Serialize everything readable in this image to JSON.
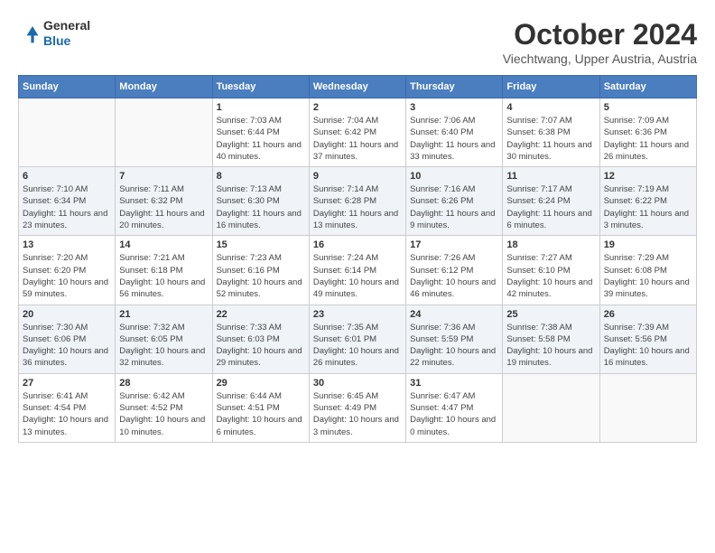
{
  "header": {
    "logo": {
      "general": "General",
      "blue": "Blue"
    },
    "title": "October 2024",
    "location": "Viechtwang, Upper Austria, Austria"
  },
  "weekdays": [
    "Sunday",
    "Monday",
    "Tuesday",
    "Wednesday",
    "Thursday",
    "Friday",
    "Saturday"
  ],
  "weeks": [
    [
      {
        "day": "",
        "sunrise": "",
        "sunset": "",
        "daylight": ""
      },
      {
        "day": "",
        "sunrise": "",
        "sunset": "",
        "daylight": ""
      },
      {
        "day": "1",
        "sunrise": "Sunrise: 7:03 AM",
        "sunset": "Sunset: 6:44 PM",
        "daylight": "Daylight: 11 hours and 40 minutes."
      },
      {
        "day": "2",
        "sunrise": "Sunrise: 7:04 AM",
        "sunset": "Sunset: 6:42 PM",
        "daylight": "Daylight: 11 hours and 37 minutes."
      },
      {
        "day": "3",
        "sunrise": "Sunrise: 7:06 AM",
        "sunset": "Sunset: 6:40 PM",
        "daylight": "Daylight: 11 hours and 33 minutes."
      },
      {
        "day": "4",
        "sunrise": "Sunrise: 7:07 AM",
        "sunset": "Sunset: 6:38 PM",
        "daylight": "Daylight: 11 hours and 30 minutes."
      },
      {
        "day": "5",
        "sunrise": "Sunrise: 7:09 AM",
        "sunset": "Sunset: 6:36 PM",
        "daylight": "Daylight: 11 hours and 26 minutes."
      }
    ],
    [
      {
        "day": "6",
        "sunrise": "Sunrise: 7:10 AM",
        "sunset": "Sunset: 6:34 PM",
        "daylight": "Daylight: 11 hours and 23 minutes."
      },
      {
        "day": "7",
        "sunrise": "Sunrise: 7:11 AM",
        "sunset": "Sunset: 6:32 PM",
        "daylight": "Daylight: 11 hours and 20 minutes."
      },
      {
        "day": "8",
        "sunrise": "Sunrise: 7:13 AM",
        "sunset": "Sunset: 6:30 PM",
        "daylight": "Daylight: 11 hours and 16 minutes."
      },
      {
        "day": "9",
        "sunrise": "Sunrise: 7:14 AM",
        "sunset": "Sunset: 6:28 PM",
        "daylight": "Daylight: 11 hours and 13 minutes."
      },
      {
        "day": "10",
        "sunrise": "Sunrise: 7:16 AM",
        "sunset": "Sunset: 6:26 PM",
        "daylight": "Daylight: 11 hours and 9 minutes."
      },
      {
        "day": "11",
        "sunrise": "Sunrise: 7:17 AM",
        "sunset": "Sunset: 6:24 PM",
        "daylight": "Daylight: 11 hours and 6 minutes."
      },
      {
        "day": "12",
        "sunrise": "Sunrise: 7:19 AM",
        "sunset": "Sunset: 6:22 PM",
        "daylight": "Daylight: 11 hours and 3 minutes."
      }
    ],
    [
      {
        "day": "13",
        "sunrise": "Sunrise: 7:20 AM",
        "sunset": "Sunset: 6:20 PM",
        "daylight": "Daylight: 10 hours and 59 minutes."
      },
      {
        "day": "14",
        "sunrise": "Sunrise: 7:21 AM",
        "sunset": "Sunset: 6:18 PM",
        "daylight": "Daylight: 10 hours and 56 minutes."
      },
      {
        "day": "15",
        "sunrise": "Sunrise: 7:23 AM",
        "sunset": "Sunset: 6:16 PM",
        "daylight": "Daylight: 10 hours and 52 minutes."
      },
      {
        "day": "16",
        "sunrise": "Sunrise: 7:24 AM",
        "sunset": "Sunset: 6:14 PM",
        "daylight": "Daylight: 10 hours and 49 minutes."
      },
      {
        "day": "17",
        "sunrise": "Sunrise: 7:26 AM",
        "sunset": "Sunset: 6:12 PM",
        "daylight": "Daylight: 10 hours and 46 minutes."
      },
      {
        "day": "18",
        "sunrise": "Sunrise: 7:27 AM",
        "sunset": "Sunset: 6:10 PM",
        "daylight": "Daylight: 10 hours and 42 minutes."
      },
      {
        "day": "19",
        "sunrise": "Sunrise: 7:29 AM",
        "sunset": "Sunset: 6:08 PM",
        "daylight": "Daylight: 10 hours and 39 minutes."
      }
    ],
    [
      {
        "day": "20",
        "sunrise": "Sunrise: 7:30 AM",
        "sunset": "Sunset: 6:06 PM",
        "daylight": "Daylight: 10 hours and 36 minutes."
      },
      {
        "day": "21",
        "sunrise": "Sunrise: 7:32 AM",
        "sunset": "Sunset: 6:05 PM",
        "daylight": "Daylight: 10 hours and 32 minutes."
      },
      {
        "day": "22",
        "sunrise": "Sunrise: 7:33 AM",
        "sunset": "Sunset: 6:03 PM",
        "daylight": "Daylight: 10 hours and 29 minutes."
      },
      {
        "day": "23",
        "sunrise": "Sunrise: 7:35 AM",
        "sunset": "Sunset: 6:01 PM",
        "daylight": "Daylight: 10 hours and 26 minutes."
      },
      {
        "day": "24",
        "sunrise": "Sunrise: 7:36 AM",
        "sunset": "Sunset: 5:59 PM",
        "daylight": "Daylight: 10 hours and 22 minutes."
      },
      {
        "day": "25",
        "sunrise": "Sunrise: 7:38 AM",
        "sunset": "Sunset: 5:58 PM",
        "daylight": "Daylight: 10 hours and 19 minutes."
      },
      {
        "day": "26",
        "sunrise": "Sunrise: 7:39 AM",
        "sunset": "Sunset: 5:56 PM",
        "daylight": "Daylight: 10 hours and 16 minutes."
      }
    ],
    [
      {
        "day": "27",
        "sunrise": "Sunrise: 6:41 AM",
        "sunset": "Sunset: 4:54 PM",
        "daylight": "Daylight: 10 hours and 13 minutes."
      },
      {
        "day": "28",
        "sunrise": "Sunrise: 6:42 AM",
        "sunset": "Sunset: 4:52 PM",
        "daylight": "Daylight: 10 hours and 10 minutes."
      },
      {
        "day": "29",
        "sunrise": "Sunrise: 6:44 AM",
        "sunset": "Sunset: 4:51 PM",
        "daylight": "Daylight: 10 hours and 6 minutes."
      },
      {
        "day": "30",
        "sunrise": "Sunrise: 6:45 AM",
        "sunset": "Sunset: 4:49 PM",
        "daylight": "Daylight: 10 hours and 3 minutes."
      },
      {
        "day": "31",
        "sunrise": "Sunrise: 6:47 AM",
        "sunset": "Sunset: 4:47 PM",
        "daylight": "Daylight: 10 hours and 0 minutes."
      },
      {
        "day": "",
        "sunrise": "",
        "sunset": "",
        "daylight": ""
      },
      {
        "day": "",
        "sunrise": "",
        "sunset": "",
        "daylight": ""
      }
    ]
  ]
}
